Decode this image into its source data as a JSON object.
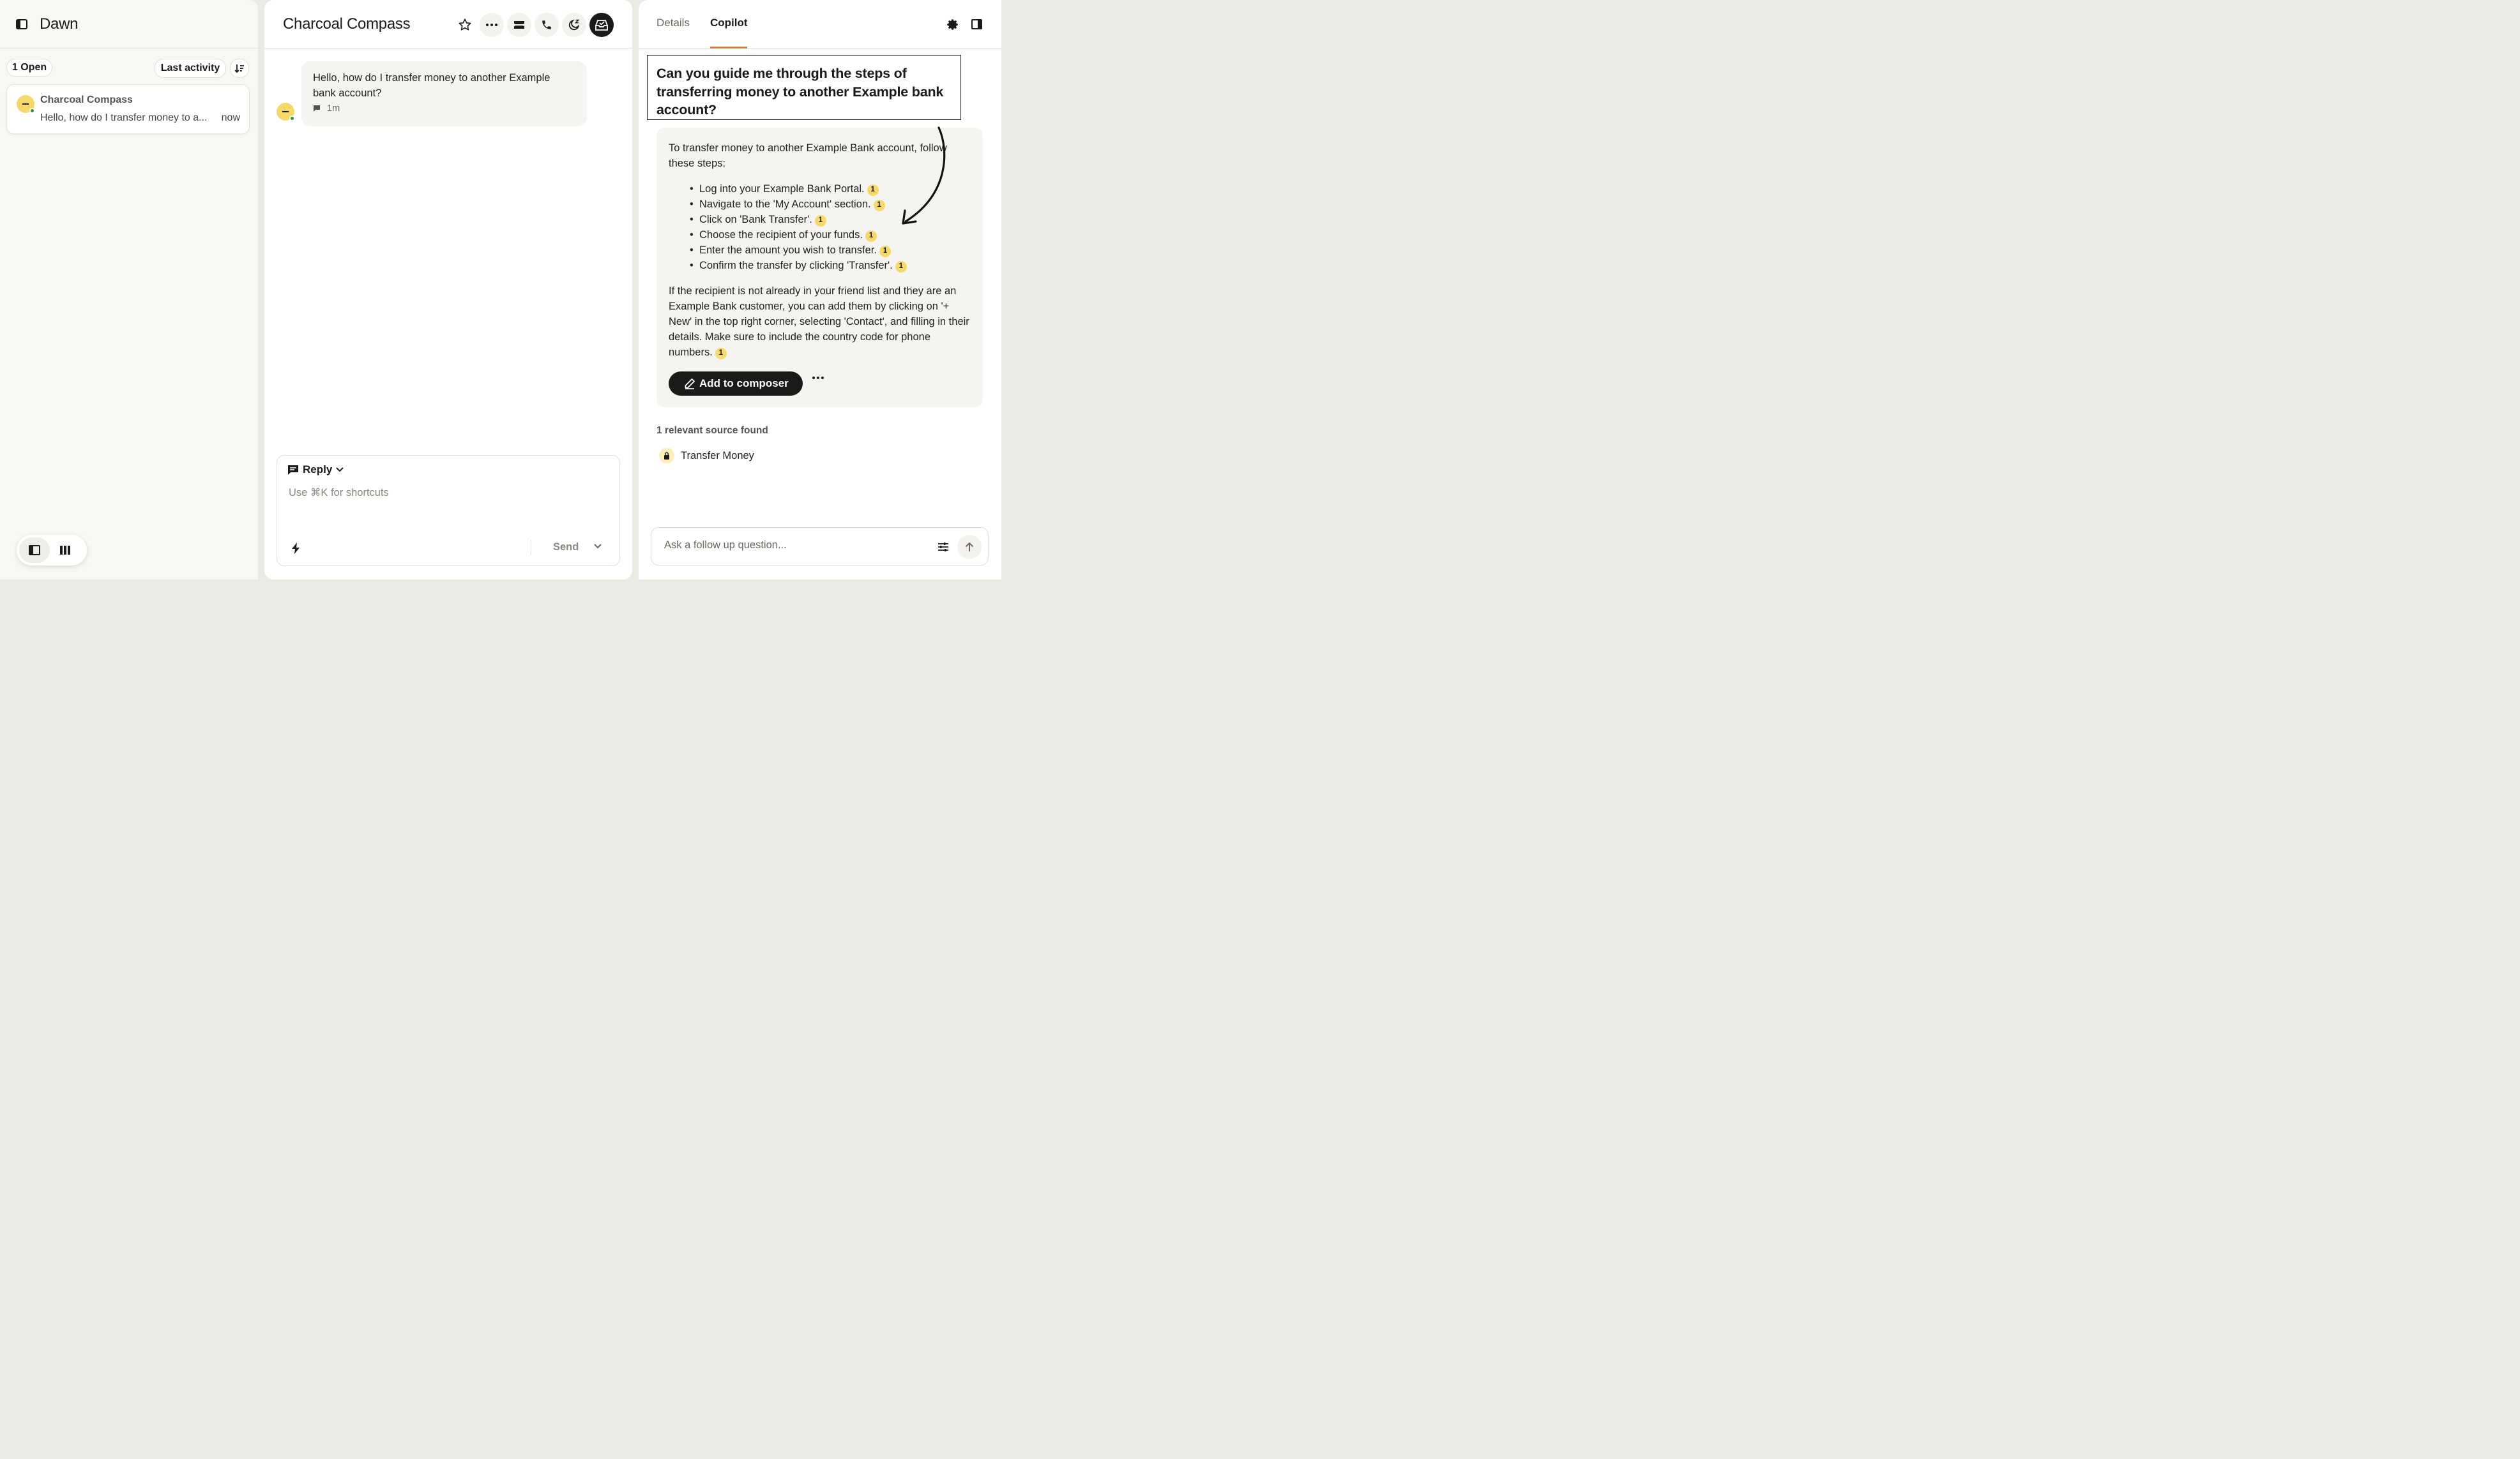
{
  "left": {
    "title": "Dawn",
    "open_count": "1 Open",
    "sort_label": "Last activity",
    "conversation": {
      "name": "Charcoal Compass",
      "preview": "Hello, how do I transfer money to a...",
      "time": "now"
    }
  },
  "mid": {
    "title": "Charcoal Compass",
    "message": {
      "text": "Hello, how do I transfer money to another Example bank account?",
      "time": "1m"
    },
    "composer": {
      "mode": "Reply",
      "placeholder": "Use ⌘K for shortcuts",
      "send_label": "Send"
    }
  },
  "right": {
    "tabs": [
      {
        "label": "Details"
      },
      {
        "label": "Copilot"
      }
    ],
    "question": "Can you guide me through the steps of transferring money to another Example bank account?",
    "answer": {
      "intro": "To transfer money to another Example Bank account, follow these steps:",
      "steps": [
        {
          "text": "Log into your Example Bank Portal.",
          "cite": "1"
        },
        {
          "text": "Navigate to the 'My Account' section.",
          "cite": "1"
        },
        {
          "text": "Click on 'Bank Transfer'.",
          "cite": "1"
        },
        {
          "text": "Choose the recipient of your funds.",
          "cite": "1"
        },
        {
          "text": "Enter the amount you wish to transfer.",
          "cite": "1"
        },
        {
          "text": "Confirm the transfer by clicking 'Transfer'.",
          "cite": "1"
        }
      ],
      "outro": "If the recipient is not already in your friend list and they are an Example Bank customer, you can add them by clicking on '+ New' in the top right corner, selecting 'Contact', and filling in their details. Make sure to include the country code for phone numbers.",
      "outro_cite": "1",
      "add_button": "Add to composer"
    },
    "sources_label": "1 relevant source found",
    "source": "Transfer Money",
    "followup_placeholder": "Ask a follow up question..."
  },
  "colors": {
    "accent": "#e07a3f",
    "avatar": "#f6d96b",
    "online": "#2f8c3a",
    "dark": "#1a1a1a"
  }
}
